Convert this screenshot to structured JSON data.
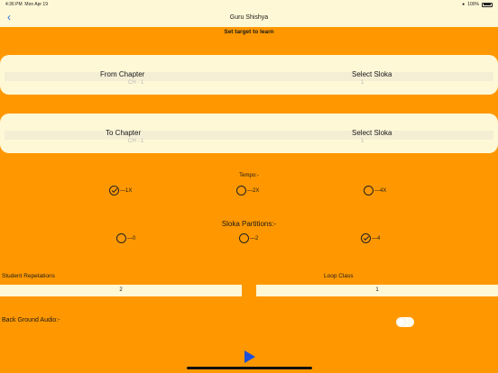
{
  "statusbar": {
    "time": "4:36 PM",
    "date": "Mon Apr 19",
    "battery_text": "100%"
  },
  "header": {
    "title": "Guru Shishya",
    "back_icon": "chevron-left-icon"
  },
  "subtitle": "Set target to learn",
  "from_card": {
    "chapter_label": "From Chapter",
    "chapter_value": "CH - 1",
    "sloka_label": "Select Sloka",
    "sloka_value": "1"
  },
  "to_card": {
    "chapter_label": "To Chapter",
    "chapter_value": "CH - 1",
    "sloka_label": "Select Sloka",
    "sloka_value": "1"
  },
  "tempo": {
    "label": "Tempo:-",
    "options": [
      {
        "label": "1X",
        "checked": true
      },
      {
        "label": "2X",
        "checked": false
      },
      {
        "label": "4X",
        "checked": false
      }
    ]
  },
  "partitions": {
    "label": "Sloka Partitions:-",
    "options": [
      {
        "label": "0",
        "checked": false
      },
      {
        "label": "2",
        "checked": false
      },
      {
        "label": "4",
        "checked": true
      }
    ]
  },
  "student_repetitions": {
    "label": "Student Repetations",
    "value": "2"
  },
  "loop_class": {
    "label": "Loop Class",
    "value": "1"
  },
  "background_audio": {
    "label": "Back Ground Audio:-",
    "enabled": false
  },
  "play_icon": "play-icon",
  "colors": {
    "background": "#ff9800",
    "card": "#fff8d6",
    "accent": "#1e4fd9"
  }
}
